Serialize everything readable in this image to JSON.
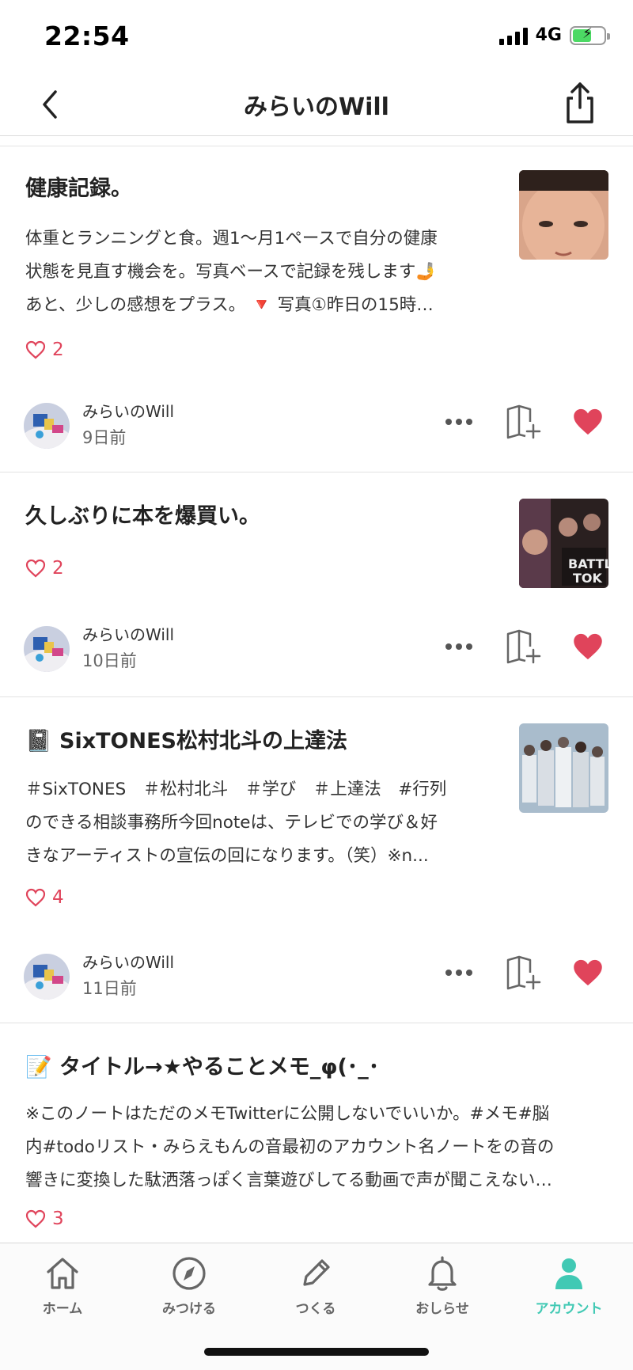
{
  "status_bar": {
    "time": "22:54",
    "network": "4G",
    "battery_level": 0.6
  },
  "header": {
    "title": "みらいのWill"
  },
  "colors": {
    "accent": "#41c9b4",
    "like": "#e0445b"
  },
  "articles": [
    {
      "title": "健康記録。",
      "excerpt": [
        "体重とランニングと食。週1〜月1ペースで自分の健康",
        "状態を見直す機会を。写真ベースで記録を残します🤳",
        "あと、少しの感想をプラス。 🔻 写真①昨日の15時…"
      ],
      "likes": "2",
      "author": "みらいのWill",
      "date": "9日前"
    },
    {
      "title": "久しぶりに本を爆買い。",
      "excerpt": [],
      "likes": "2",
      "author": "みらいのWill",
      "date": "10日前"
    },
    {
      "title": "📓 SixTONES松村北斗の上達法",
      "excerpt": [
        "＃SixTONES　＃松村北斗　＃学び　＃上達法　#行列",
        "のできる相談事務所今回noteは、テレビでの学び＆好",
        "きなアーティストの宣伝の回になります。（笑）※n..."
      ],
      "likes": "4",
      "author": "みらいのWill",
      "date": "11日前"
    },
    {
      "title": "📝 タイトル→★やることメモ_φ(･_･",
      "excerpt": [
        "※このノートはただのメモTwitterに公開しないでいいか。#メモ#脳",
        "内#todoリスト・みらえもんの音最初のアカウント名ノートをの音の",
        "響きに変換した駄洒落っぽく言葉遊びしてる動画で声が聞こえない…"
      ],
      "likes": "3",
      "author": "",
      "date": ""
    }
  ],
  "tabs": [
    {
      "label": "ホーム",
      "icon": "home-icon"
    },
    {
      "label": "みつける",
      "icon": "compass-icon"
    },
    {
      "label": "つくる",
      "icon": "pencil-icon"
    },
    {
      "label": "おしらせ",
      "icon": "bell-icon"
    },
    {
      "label": "アカウント",
      "icon": "person-icon"
    }
  ]
}
